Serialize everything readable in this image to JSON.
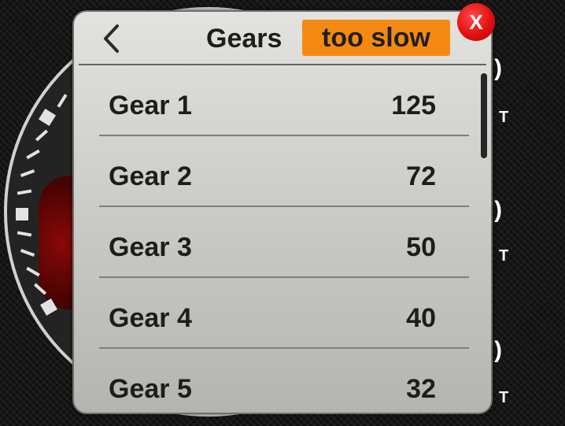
{
  "header": {
    "title": "Gears",
    "status": "too slow",
    "back_icon": "chevron-left-icon",
    "close_label": "X"
  },
  "gears": [
    {
      "label": "Gear 1",
      "value": "125"
    },
    {
      "label": "Gear 2",
      "value": "72"
    },
    {
      "label": "Gear 3",
      "value": "50"
    },
    {
      "label": "Gear 4",
      "value": "40"
    },
    {
      "label": "Gear 5",
      "value": "32"
    }
  ],
  "background": {
    "right_labels": [
      {
        "paren": ")",
        "small": "T"
      },
      {
        "paren": ")",
        "small": "T"
      },
      {
        "paren": ")",
        "small": "T"
      }
    ]
  },
  "colors": {
    "accent": "#f58a12",
    "close": "#e41010",
    "dialog_top": "#e2e2de",
    "dialog_bottom": "#b4b4b0"
  }
}
